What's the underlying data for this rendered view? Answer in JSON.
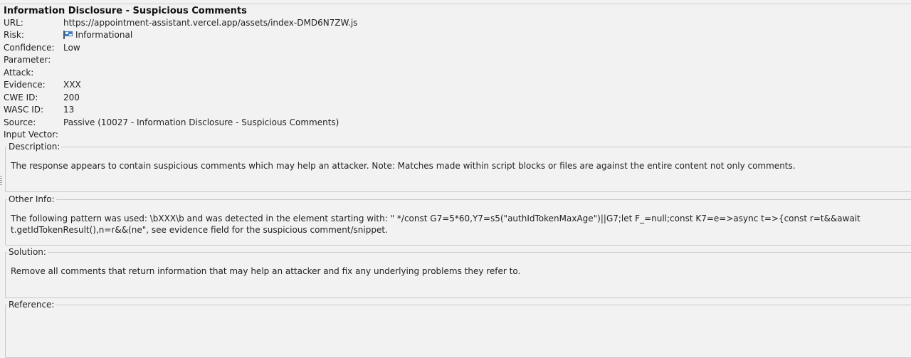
{
  "alert": {
    "title": "Information Disclosure - Suspicious Comments",
    "fields": {
      "url": {
        "label": "URL:",
        "value": "https://appointment-assistant.vercel.app/assets/index-DMD6N7ZW.js"
      },
      "risk": {
        "label": "Risk:",
        "value": "Informational",
        "icon": "flag-icon",
        "icon_color": "#3d7ec8"
      },
      "confidence": {
        "label": "Confidence:",
        "value": "Low"
      },
      "parameter": {
        "label": "Parameter:",
        "value": ""
      },
      "attack": {
        "label": "Attack:",
        "value": ""
      },
      "evidence": {
        "label": "Evidence:",
        "value": "XXX"
      },
      "cwe_id": {
        "label": "CWE ID:",
        "value": "200"
      },
      "wasc_id": {
        "label": "WASC ID:",
        "value": "13"
      },
      "source": {
        "label": "Source:",
        "value": "Passive (10027 - Information Disclosure - Suspicious Comments)"
      },
      "input_vector": {
        "label": "Input Vector:",
        "value": ""
      }
    },
    "sections": {
      "description": {
        "label": "Description:",
        "text": "The response appears to contain suspicious comments which may help an attacker. Note: Matches made within script blocks or files are against the entire content not only comments."
      },
      "other_info": {
        "label": "Other Info:",
        "text": "The following pattern was used: \\bXXX\\b and was detected in the element starting with: \" */const G7=5*60,Y7=s5(\"authIdTokenMaxAge\")||G7;let F_=null;const K7=e=>async t=>{const r=t&&await t.getIdTokenResult(),n=r&&(ne\", see evidence field for the suspicious comment/snippet."
      },
      "solution": {
        "label": "Solution:",
        "text": "Remove all comments that return information that may help an attacker and fix any underlying problems they refer to."
      },
      "reference": {
        "label": "Reference:",
        "text": ""
      }
    }
  }
}
